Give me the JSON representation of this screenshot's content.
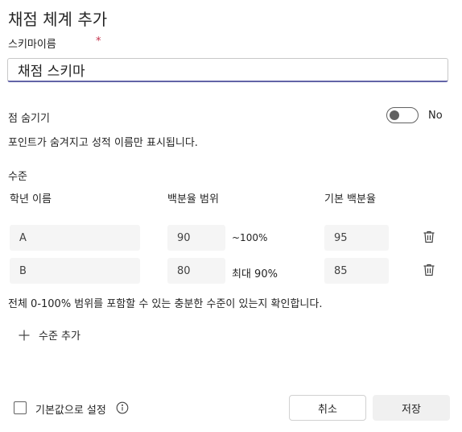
{
  "dialog": {
    "title": "채점 체계 추가",
    "scheme_name_label": "스키마이름",
    "required_mark": "*",
    "scheme_name_value": "채점 스키마"
  },
  "hide_points": {
    "label": "점 숨기기",
    "toggle_state": "No",
    "description": "포인트가 숨겨지고 성적 이름만 표시됩니다."
  },
  "levels": {
    "section_label": "수준",
    "headers": {
      "grade_name": "학년 이름",
      "percent_range": "백분율 범위",
      "default_percent": "기본 백분율"
    },
    "rows": [
      {
        "name": "A",
        "range_start": "90",
        "range_end": "~100%",
        "default": "95"
      },
      {
        "name": "B",
        "range_start": "80",
        "range_end": "최대 90%",
        "default": "85"
      }
    ],
    "coverage_note": "전체 0-100% 범위를 포함할 수 있는 충분한 수준이 있는지 확인합니다.",
    "add_level_label": "수준 추가"
  },
  "footer": {
    "set_default_label": "기본값으로 설정",
    "cancel_label": "취소",
    "save_label": "저장"
  }
}
